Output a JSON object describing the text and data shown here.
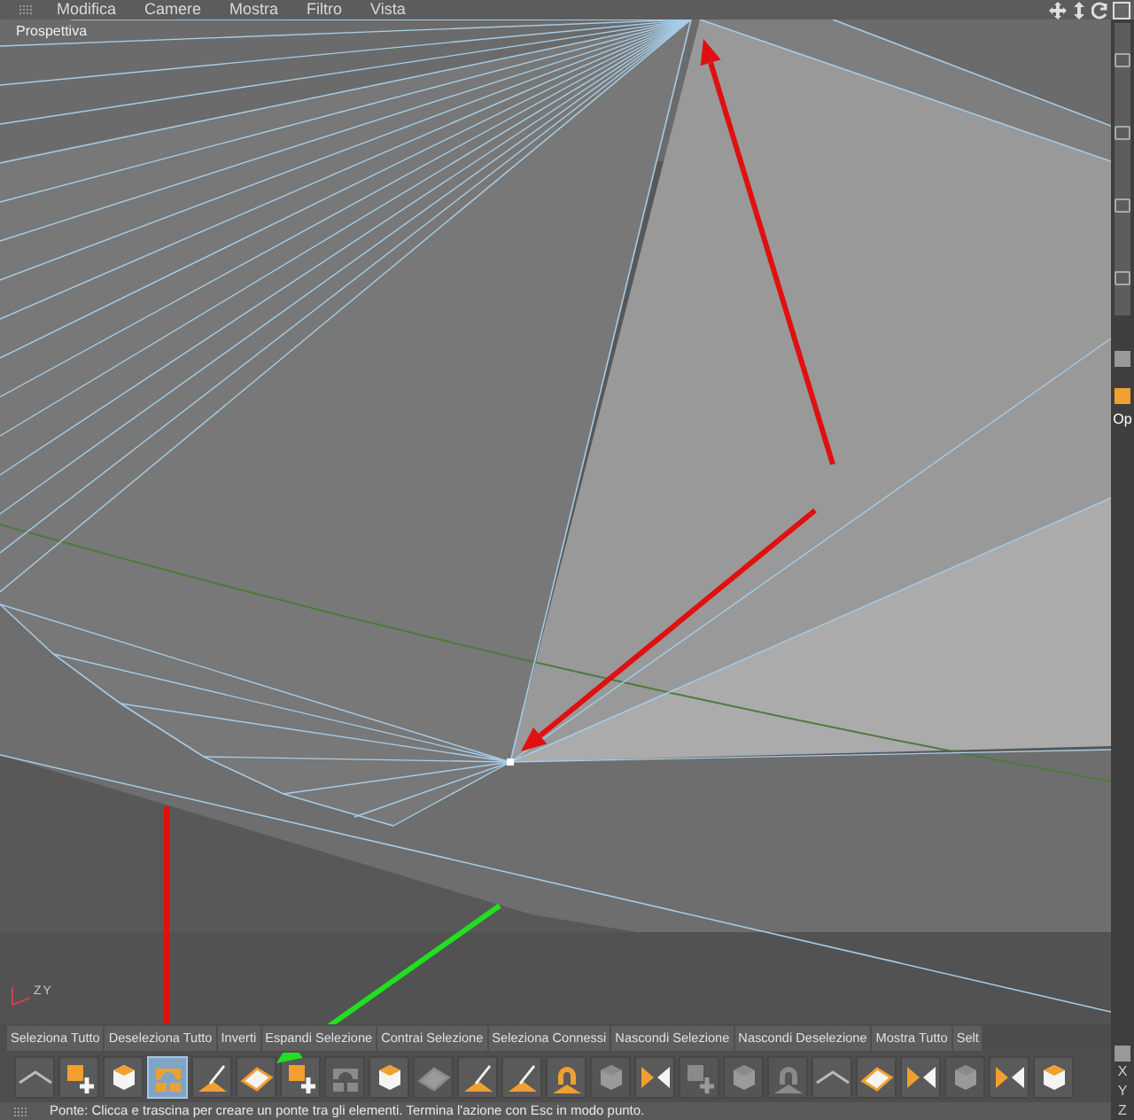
{
  "menu": {
    "items": [
      "Modifica",
      "Camere",
      "Mostra",
      "Filtro",
      "Vista"
    ]
  },
  "viewport": {
    "title": "Prospettiva",
    "axes": [
      "Z",
      "Y"
    ]
  },
  "side_panel": {
    "label": "Op",
    "axes": [
      "X",
      "Y",
      "Z"
    ]
  },
  "tabs": [
    {
      "label": "Seleziona Tutto"
    },
    {
      "label": "Deseleziona Tutto"
    },
    {
      "label": "Inverti"
    },
    {
      "label": "Espandi Selezione"
    },
    {
      "label": "Contrai Selezione"
    },
    {
      "label": "Seleziona Connessi"
    },
    {
      "label": "Nascondi Selezione"
    },
    {
      "label": "Nascondi Deselezione"
    },
    {
      "label": "Mostra Tutto"
    },
    {
      "label": "Selt"
    }
  ],
  "toolbar": [
    {
      "kind": "line",
      "selected": false,
      "disabled": false
    },
    {
      "kind": "add",
      "selected": false,
      "disabled": false
    },
    {
      "kind": "cube",
      "selected": false,
      "disabled": false
    },
    {
      "kind": "bridge",
      "selected": true,
      "disabled": false
    },
    {
      "kind": "knife",
      "selected": false,
      "disabled": false
    },
    {
      "kind": "plane",
      "selected": false,
      "disabled": false
    },
    {
      "kind": "add",
      "selected": false,
      "disabled": false
    },
    {
      "kind": "bridge",
      "selected": false,
      "disabled": true
    },
    {
      "kind": "cube",
      "selected": false,
      "disabled": false
    },
    {
      "kind": "plane",
      "selected": false,
      "disabled": true
    },
    {
      "kind": "knife",
      "selected": false,
      "disabled": false
    },
    {
      "kind": "knife",
      "selected": false,
      "disabled": false
    },
    {
      "kind": "magnet",
      "selected": false,
      "disabled": false
    },
    {
      "kind": "cube",
      "selected": false,
      "disabled": true
    },
    {
      "kind": "mirror",
      "selected": false,
      "disabled": false
    },
    {
      "kind": "add",
      "selected": false,
      "disabled": true
    },
    {
      "kind": "cube",
      "selected": false,
      "disabled": true
    },
    {
      "kind": "magnet",
      "selected": false,
      "disabled": true
    },
    {
      "kind": "line",
      "selected": false,
      "disabled": false
    },
    {
      "kind": "plane",
      "selected": false,
      "disabled": false
    },
    {
      "kind": "mirror",
      "selected": false,
      "disabled": false
    },
    {
      "kind": "cube",
      "selected": false,
      "disabled": true
    },
    {
      "kind": "mirror",
      "selected": false,
      "disabled": false
    },
    {
      "kind": "cube",
      "selected": false,
      "disabled": false
    }
  ],
  "status_bar": {
    "text": "Ponte: Clicca e trascina per creare un ponte tra gli elementi. Termina l'azione con Esc in modo punto."
  }
}
